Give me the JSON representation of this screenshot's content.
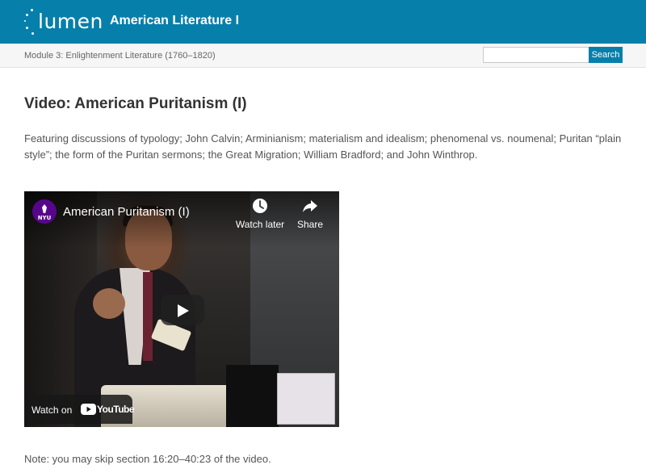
{
  "header": {
    "logo_text": "lumen",
    "course_title": "American Literature I",
    "background_color": "#077fab"
  },
  "subheader": {
    "breadcrumb": "Module 3: Enlightenment Literature (1760–1820)",
    "search": {
      "placeholder": "",
      "value": "",
      "button_label": "Search"
    }
  },
  "content": {
    "title": "Video: American Puritanism (I)",
    "intro": "Featuring discussions of typology; John Calvin; Arminianism; materialism and idealism; phenomenal vs. noumenal; Puritan “plain style”; the form of the Puritan sermons; the Great Migration; William Bradford; and John Winthrop.",
    "note": "Note: you may skip section 16:20–40:23 of the video."
  },
  "video": {
    "channel_badge": "NYU",
    "title": "American Puritanism (I)",
    "watch_later_label": "Watch later",
    "share_label": "Share",
    "watch_on_label": "Watch on",
    "youtube_wordmark": "YouTube",
    "icons": {
      "watch_later": "clock-icon",
      "share": "share-arrow-icon",
      "play": "play-icon"
    }
  }
}
